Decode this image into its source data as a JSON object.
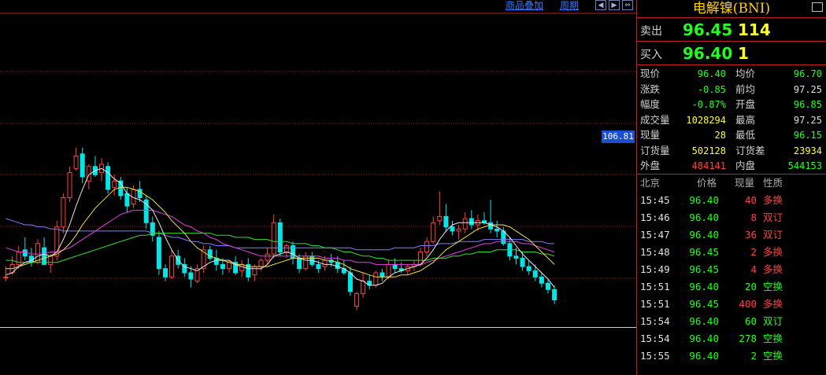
{
  "toolbar": {
    "link1": "商品叠加",
    "link2": "周期"
  },
  "price_tag": "106.81",
  "panel": {
    "title": "电解镍(BNI)",
    "sell": {
      "label": "卖出",
      "price": "96.45",
      "volume": "114"
    },
    "buy": {
      "label": "买入",
      "price": "96.40",
      "volume": "1"
    },
    "stats": [
      {
        "l": "现价",
        "v": "96.40",
        "vc": "#20ff20",
        "l2": "均价",
        "v2": "96.70",
        "v2c": "#20ff20"
      },
      {
        "l": "涨跌",
        "v": "-0.85",
        "vc": "#20ff20",
        "l2": "前均",
        "v2": "97.25",
        "v2c": "#e0e0e0"
      },
      {
        "l": "幅度",
        "v": "-0.87%",
        "vc": "#20ff20",
        "l2": "开盘",
        "v2": "96.85",
        "v2c": "#20ff20"
      },
      {
        "l": "成交量",
        "v": "1028294",
        "vc": "#ffff30",
        "l2": "最高",
        "v2": "97.25",
        "v2c": "#e0e0e0"
      },
      {
        "l": "现量",
        "v": "28",
        "vc": "#ffff30",
        "l2": "最低",
        "v2": "96.15",
        "v2c": "#20ff20"
      },
      {
        "l": "订货量",
        "v": "502128",
        "vc": "#ffff30",
        "l2": "订货差",
        "v2": "23934",
        "v2c": "#ffff30"
      },
      {
        "l": "外盘",
        "v": "484141",
        "vc": "#ff4040",
        "l2": "内盘",
        "v2": "544153",
        "v2c": "#20ff20"
      }
    ],
    "ticks_header": {
      "time": "北京",
      "price": "价格",
      "qty": "现量",
      "nature": "性质"
    },
    "ticks": [
      {
        "time": "15:45",
        "price": "96.40",
        "qty": "40",
        "qty_color": "#ff4040",
        "nature": "多换",
        "nature_color": "#ff4040"
      },
      {
        "time": "15:46",
        "price": "96.40",
        "qty": "8",
        "qty_color": "#ff4040",
        "nature": "双订",
        "nature_color": "#ff4040"
      },
      {
        "time": "15:47",
        "price": "96.40",
        "qty": "36",
        "qty_color": "#ff4040",
        "nature": "双订",
        "nature_color": "#ff4040"
      },
      {
        "time": "15:48",
        "price": "96.45",
        "qty": "2",
        "qty_color": "#ff4040",
        "nature": "多换",
        "nature_color": "#ff4040"
      },
      {
        "time": "15:49",
        "price": "96.45",
        "qty": "4",
        "qty_color": "#ff4040",
        "nature": "多换",
        "nature_color": "#ff4040"
      },
      {
        "time": "15:51",
        "price": "96.40",
        "qty": "20",
        "qty_color": "#20ff20",
        "nature": "空换",
        "nature_color": "#20ff20"
      },
      {
        "time": "15:51",
        "price": "96.45",
        "qty": "400",
        "qty_color": "#ff4040",
        "nature": "多换",
        "nature_color": "#ff4040"
      },
      {
        "time": "15:54",
        "price": "96.40",
        "qty": "60",
        "qty_color": "#20ff20",
        "nature": "双订",
        "nature_color": "#20ff20"
      },
      {
        "time": "15:54",
        "price": "96.40",
        "qty": "278",
        "qty_color": "#20ff20",
        "nature": "空换",
        "nature_color": "#20ff20"
      },
      {
        "time": "15:55",
        "price": "96.40",
        "qty": "2",
        "qty_color": "#20ff20",
        "nature": "空换",
        "nature_color": "#20ff20"
      }
    ]
  },
  "colors": {
    "up": "#ff4040",
    "down": "#00e5e5",
    "grid": "#a01010",
    "ma5": "#e8e8e8",
    "ma10": "#e8e040",
    "ma20": "#e040e0",
    "ma40": "#30e030",
    "ma60": "#8080ff"
  },
  "candles": [
    {
      "o": 100.4,
      "h": 100.9,
      "l": 100.2,
      "c": 100.4
    },
    {
      "o": 100.6,
      "h": 101.4,
      "l": 100.5,
      "c": 101.0
    },
    {
      "o": 101.0,
      "h": 101.9,
      "l": 100.8,
      "c": 101.6
    },
    {
      "o": 101.7,
      "h": 102.3,
      "l": 101.2,
      "c": 101.4
    },
    {
      "o": 101.4,
      "h": 101.8,
      "l": 100.9,
      "c": 101.1
    },
    {
      "o": 101.1,
      "h": 102.2,
      "l": 101.0,
      "c": 102.0
    },
    {
      "o": 101.8,
      "h": 102.3,
      "l": 101.0,
      "c": 101.0
    },
    {
      "o": 101.0,
      "h": 101.5,
      "l": 100.6,
      "c": 101.4
    },
    {
      "o": 101.4,
      "h": 103.1,
      "l": 101.2,
      "c": 102.8
    },
    {
      "o": 102.8,
      "h": 104.4,
      "l": 102.5,
      "c": 104.2
    },
    {
      "o": 104.2,
      "h": 105.7,
      "l": 104.0,
      "c": 105.4
    },
    {
      "o": 105.6,
      "h": 106.6,
      "l": 105.5,
      "c": 106.2
    },
    {
      "o": 106.3,
      "h": 106.6,
      "l": 104.9,
      "c": 105.2
    },
    {
      "o": 105.0,
      "h": 105.8,
      "l": 104.6,
      "c": 105.7
    },
    {
      "o": 105.7,
      "h": 106.2,
      "l": 105.2,
      "c": 105.3
    },
    {
      "o": 105.4,
      "h": 106.1,
      "l": 105.0,
      "c": 105.8
    },
    {
      "o": 105.7,
      "h": 105.9,
      "l": 104.4,
      "c": 104.6
    },
    {
      "o": 104.7,
      "h": 105.3,
      "l": 104.3,
      "c": 105.0
    },
    {
      "o": 105.0,
      "h": 105.2,
      "l": 104.1,
      "c": 104.3
    },
    {
      "o": 104.4,
      "h": 104.7,
      "l": 103.5,
      "c": 103.8
    },
    {
      "o": 103.9,
      "h": 104.8,
      "l": 103.7,
      "c": 104.6
    },
    {
      "o": 104.6,
      "h": 105.0,
      "l": 104.0,
      "c": 104.2
    },
    {
      "o": 104.1,
      "h": 104.3,
      "l": 102.7,
      "c": 103.0
    },
    {
      "o": 103.0,
      "h": 103.3,
      "l": 102.1,
      "c": 102.4
    },
    {
      "o": 102.3,
      "h": 102.6,
      "l": 100.5,
      "c": 100.8
    },
    {
      "o": 100.8,
      "h": 101.0,
      "l": 100.2,
      "c": 100.4
    },
    {
      "o": 100.4,
      "h": 101.7,
      "l": 100.3,
      "c": 101.4
    },
    {
      "o": 101.4,
      "h": 101.7,
      "l": 100.8,
      "c": 101.0
    },
    {
      "o": 101.0,
      "h": 101.3,
      "l": 100.4,
      "c": 100.6
    },
    {
      "o": 100.6,
      "h": 100.9,
      "l": 99.9,
      "c": 100.3
    },
    {
      "o": 100.2,
      "h": 101.0,
      "l": 100.1,
      "c": 100.8
    },
    {
      "o": 100.8,
      "h": 101.9,
      "l": 100.6,
      "c": 101.7
    },
    {
      "o": 101.7,
      "h": 101.9,
      "l": 101.2,
      "c": 101.3
    },
    {
      "o": 101.3,
      "h": 101.7,
      "l": 100.7,
      "c": 101.0
    },
    {
      "o": 101.0,
      "h": 101.3,
      "l": 100.5,
      "c": 100.8
    },
    {
      "o": 100.8,
      "h": 101.2,
      "l": 100.6,
      "c": 101.1
    },
    {
      "o": 101.1,
      "h": 101.4,
      "l": 100.5,
      "c": 100.6
    },
    {
      "o": 100.7,
      "h": 101.2,
      "l": 100.4,
      "c": 101.0
    },
    {
      "o": 101.0,
      "h": 101.3,
      "l": 100.2,
      "c": 100.4
    },
    {
      "o": 100.5,
      "h": 101.0,
      "l": 100.2,
      "c": 100.9
    },
    {
      "o": 100.9,
      "h": 101.3,
      "l": 100.7,
      "c": 101.2
    },
    {
      "o": 101.2,
      "h": 101.8,
      "l": 101.0,
      "c": 101.5
    },
    {
      "o": 101.5,
      "h": 103.4,
      "l": 101.3,
      "c": 103.0
    },
    {
      "o": 103.0,
      "h": 103.2,
      "l": 101.4,
      "c": 101.6
    },
    {
      "o": 101.6,
      "h": 102.0,
      "l": 101.3,
      "c": 101.9
    },
    {
      "o": 101.9,
      "h": 102.1,
      "l": 101.0,
      "c": 101.3
    },
    {
      "o": 101.3,
      "h": 101.5,
      "l": 100.6,
      "c": 100.8
    },
    {
      "o": 100.8,
      "h": 101.6,
      "l": 100.7,
      "c": 101.4
    },
    {
      "o": 101.4,
      "h": 101.6,
      "l": 100.9,
      "c": 101.0
    },
    {
      "o": 101.0,
      "h": 101.2,
      "l": 100.6,
      "c": 100.8
    },
    {
      "o": 100.9,
      "h": 101.4,
      "l": 100.7,
      "c": 101.2
    },
    {
      "o": 101.2,
      "h": 101.5,
      "l": 100.9,
      "c": 101.1
    },
    {
      "o": 101.1,
      "h": 101.4,
      "l": 100.6,
      "c": 100.8
    },
    {
      "o": 100.8,
      "h": 101.2,
      "l": 100.5,
      "c": 100.6
    },
    {
      "o": 100.6,
      "h": 100.9,
      "l": 99.5,
      "c": 99.7
    },
    {
      "o": 99.0,
      "h": 99.7,
      "l": 98.8,
      "c": 99.6
    },
    {
      "o": 99.6,
      "h": 100.6,
      "l": 99.4,
      "c": 100.2
    },
    {
      "o": 100.2,
      "h": 100.5,
      "l": 99.8,
      "c": 100.0
    },
    {
      "o": 100.0,
      "h": 100.7,
      "l": 99.9,
      "c": 100.6
    },
    {
      "o": 100.6,
      "h": 100.8,
      "l": 100.2,
      "c": 100.4
    },
    {
      "o": 100.4,
      "h": 101.2,
      "l": 100.3,
      "c": 101.0
    },
    {
      "o": 101.0,
      "h": 101.3,
      "l": 100.6,
      "c": 100.8
    },
    {
      "o": 100.8,
      "h": 101.1,
      "l": 100.6,
      "c": 100.7
    },
    {
      "o": 100.7,
      "h": 101.0,
      "l": 100.5,
      "c": 100.9
    },
    {
      "o": 100.9,
      "h": 101.2,
      "l": 100.7,
      "c": 101.0
    },
    {
      "o": 101.0,
      "h": 101.8,
      "l": 100.9,
      "c": 101.6
    },
    {
      "o": 101.6,
      "h": 102.3,
      "l": 101.4,
      "c": 102.1
    },
    {
      "o": 102.1,
      "h": 103.3,
      "l": 102.0,
      "c": 103.0
    },
    {
      "o": 103.1,
      "h": 104.5,
      "l": 102.9,
      "c": 103.3
    },
    {
      "o": 103.3,
      "h": 103.9,
      "l": 102.6,
      "c": 102.8
    },
    {
      "o": 102.8,
      "h": 103.1,
      "l": 102.4,
      "c": 102.6
    },
    {
      "o": 102.6,
      "h": 102.9,
      "l": 102.2,
      "c": 102.7
    },
    {
      "o": 102.7,
      "h": 103.5,
      "l": 102.5,
      "c": 103.2
    },
    {
      "o": 103.2,
      "h": 103.6,
      "l": 102.7,
      "c": 102.9
    },
    {
      "o": 102.9,
      "h": 103.4,
      "l": 102.6,
      "c": 103.1
    },
    {
      "o": 103.1,
      "h": 103.5,
      "l": 102.9,
      "c": 103.0
    },
    {
      "o": 103.0,
      "h": 104.1,
      "l": 102.5,
      "c": 102.7
    },
    {
      "o": 102.7,
      "h": 103.1,
      "l": 102.3,
      "c": 102.6
    },
    {
      "o": 102.6,
      "h": 102.8,
      "l": 101.9,
      "c": 102.0
    },
    {
      "o": 102.0,
      "h": 102.3,
      "l": 101.2,
      "c": 101.4
    },
    {
      "o": 101.4,
      "h": 101.8,
      "l": 101.0,
      "c": 101.3
    },
    {
      "o": 101.3,
      "h": 101.6,
      "l": 100.7,
      "c": 100.9
    },
    {
      "o": 100.9,
      "h": 101.2,
      "l": 100.5,
      "c": 100.7
    },
    {
      "o": 100.7,
      "h": 101.0,
      "l": 100.2,
      "c": 100.4
    },
    {
      "o": 100.4,
      "h": 100.6,
      "l": 99.9,
      "c": 100.1
    },
    {
      "o": 100.1,
      "h": 100.3,
      "l": 99.6,
      "c": 99.8
    },
    {
      "o": 99.8,
      "h": 100.0,
      "l": 99.1,
      "c": 99.3
    }
  ],
  "ma_lines": {
    "ma5": [
      100.5,
      100.6,
      100.9,
      101.1,
      101.2,
      101.4,
      101.5,
      101.4,
      101.6,
      102.2,
      102.9,
      103.8,
      104.6,
      105.3,
      105.5,
      105.6,
      105.4,
      105.1,
      104.9,
      104.4,
      104.2,
      104.1,
      103.9,
      103.6,
      103.0,
      102.3,
      101.7,
      101.2,
      100.9,
      100.8,
      100.7,
      100.9,
      101.1,
      101.2,
      101.2,
      101.2,
      101.0,
      100.9,
      100.8,
      100.8,
      100.8,
      101.0,
      101.4,
      101.5,
      101.6,
      101.5,
      101.3,
      101.2,
      101.2,
      101.1,
      101.0,
      101.0,
      100.9,
      100.8,
      100.6,
      100.3,
      100.2,
      100.0,
      100.0,
      100.1,
      100.4,
      100.6,
      100.7,
      100.8,
      100.9,
      101.0,
      101.3,
      101.7,
      102.2,
      102.6,
      102.9,
      103.0,
      103.0,
      103.0,
      103.0,
      103.0,
      102.9,
      102.8,
      102.6,
      102.3,
      101.9,
      101.5,
      101.2,
      100.9,
      100.6,
      100.3,
      99.9
    ],
    "ma10": [
      100.8,
      100.8,
      100.9,
      101.0,
      101.1,
      101.2,
      101.3,
      101.4,
      101.5,
      101.7,
      102.0,
      102.4,
      102.9,
      103.3,
      103.7,
      104.0,
      104.3,
      104.6,
      104.7,
      104.7,
      104.6,
      104.5,
      104.3,
      104.1,
      103.8,
      103.5,
      103.1,
      102.8,
      102.5,
      102.1,
      101.8,
      101.6,
      101.4,
      101.3,
      101.2,
      101.1,
      101.0,
      101.0,
      100.9,
      100.9,
      100.9,
      100.9,
      101.0,
      101.1,
      101.2,
      101.3,
      101.3,
      101.3,
      101.3,
      101.3,
      101.2,
      101.2,
      101.1,
      101.0,
      100.8,
      100.7,
      100.6,
      100.5,
      100.4,
      100.4,
      100.4,
      100.4,
      100.5,
      100.5,
      100.6,
      100.7,
      100.9,
      101.1,
      101.4,
      101.7,
      101.9,
      102.1,
      102.3,
      102.5,
      102.7,
      102.8,
      102.9,
      102.9,
      102.9,
      102.8,
      102.6,
      102.4,
      102.2,
      101.9,
      101.6,
      101.3,
      101.0
    ],
    "ma20": [
      101.8,
      101.7,
      101.6,
      101.6,
      101.5,
      101.5,
      101.5,
      101.6,
      101.6,
      101.7,
      101.8,
      102.0,
      102.2,
      102.4,
      102.6,
      102.8,
      103.0,
      103.2,
      103.4,
      103.5,
      103.6,
      103.6,
      103.6,
      103.6,
      103.5,
      103.4,
      103.3,
      103.1,
      102.9,
      102.8,
      102.6,
      102.5,
      102.3,
      102.2,
      102.0,
      101.9,
      101.8,
      101.7,
      101.6,
      101.5,
      101.4,
      101.4,
      101.4,
      101.4,
      101.4,
      101.4,
      101.4,
      101.4,
      101.4,
      101.4,
      101.3,
      101.3,
      101.3,
      101.2,
      101.2,
      101.1,
      101.1,
      101.1,
      101.0,
      101.0,
      101.0,
      101.0,
      101.0,
      101.0,
      101.0,
      101.0,
      101.1,
      101.2,
      101.3,
      101.4,
      101.5,
      101.6,
      101.7,
      101.8,
      101.9,
      102.0,
      102.0,
      102.1,
      102.1,
      102.1,
      102.1,
      102.0,
      102.0,
      101.9,
      101.8,
      101.7,
      101.6
    ],
    "ma40": [
      101.2,
      101.2,
      101.1,
      101.1,
      101.1,
      101.1,
      101.1,
      101.1,
      101.1,
      101.2,
      101.3,
      101.4,
      101.5,
      101.6,
      101.7,
      101.8,
      101.9,
      102.0,
      102.1,
      102.2,
      102.3,
      102.4,
      102.4,
      102.5,
      102.5,
      102.5,
      102.5,
      102.5,
      102.5,
      102.5,
      102.5,
      102.5,
      102.5,
      102.4,
      102.4,
      102.4,
      102.3,
      102.3,
      102.3,
      102.2,
      102.2,
      102.2,
      102.1,
      102.1,
      102.1,
      102.0,
      102.0,
      102.0,
      101.9,
      101.9,
      101.8,
      101.8,
      101.7,
      101.6,
      101.6,
      101.5,
      101.4,
      101.4,
      101.3,
      101.3,
      101.2,
      101.2,
      101.2,
      101.2,
      101.2,
      101.2,
      101.2,
      101.3,
      101.3,
      101.3,
      101.4,
      101.4,
      101.5,
      101.5,
      101.6,
      101.6,
      101.6,
      101.7,
      101.7,
      101.7,
      101.7,
      101.6,
      101.6,
      101.6,
      101.5,
      101.5,
      101.4
    ],
    "ma60": [
      103.2,
      103.1,
      103.0,
      102.9,
      102.9,
      102.8,
      102.8,
      102.7,
      102.7,
      102.6,
      102.6,
      102.6,
      102.6,
      102.6,
      102.6,
      102.6,
      102.6,
      102.6,
      102.6,
      102.6,
      102.6,
      102.6,
      102.6,
      102.5,
      102.5,
      102.4,
      102.3,
      102.3,
      102.2,
      102.1,
      102.1,
      102.0,
      102.0,
      101.9,
      101.9,
      101.9,
      101.8,
      101.8,
      101.8,
      101.8,
      101.8,
      101.8,
      101.8,
      101.8,
      101.8,
      101.8,
      101.8,
      101.8,
      101.8,
      101.8,
      101.8,
      101.8,
      101.8,
      101.8,
      101.8,
      101.7,
      101.7,
      101.7,
      101.7,
      101.7,
      101.7,
      101.8,
      101.8,
      101.8,
      101.8,
      101.9,
      101.9,
      101.9,
      102.0,
      102.0,
      102.0,
      102.1,
      102.1,
      102.1,
      102.1,
      102.2,
      102.2,
      102.2,
      102.2,
      102.2,
      102.2,
      102.2,
      102.1,
      102.1,
      102.1,
      102.0,
      102.0
    ]
  },
  "y_range": [
    98,
    113
  ]
}
